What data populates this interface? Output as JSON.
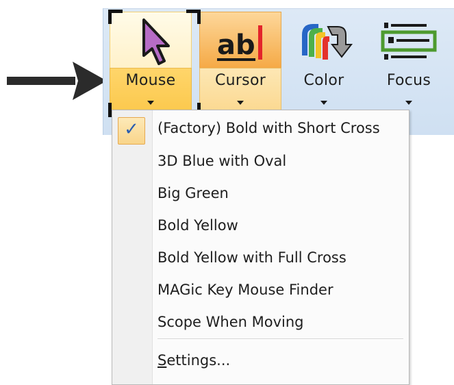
{
  "ribbon": {
    "buttons": [
      {
        "label": "Mouse",
        "icon": "mouse-pointer-icon",
        "state": "selected"
      },
      {
        "label": "Cursor",
        "icon": "text-cursor-icon",
        "state": "highlighted"
      },
      {
        "label": "Color",
        "icon": "color-scheme-icon",
        "state": "normal"
      },
      {
        "label": "Focus",
        "icon": "focus-highlight-icon",
        "state": "normal"
      }
    ]
  },
  "menu": {
    "checked_index": 0,
    "items": [
      "(Factory) Bold with Short Cross",
      "3D Blue with Oval",
      "Big Green",
      "Bold Yellow",
      "Bold Yellow with Full Cross",
      "MAGic Key Mouse Finder",
      "Scope When Moving"
    ],
    "settings": {
      "mnemonic": "S",
      "rest": "ettings..."
    }
  },
  "colors": {
    "ribbon_bg": "#cfe0f2",
    "selected_button": "#fbc84c",
    "highlight_button": "#f5a945",
    "check_color": "#2a5db0",
    "pointer_arrow": "#2b2b2b"
  }
}
